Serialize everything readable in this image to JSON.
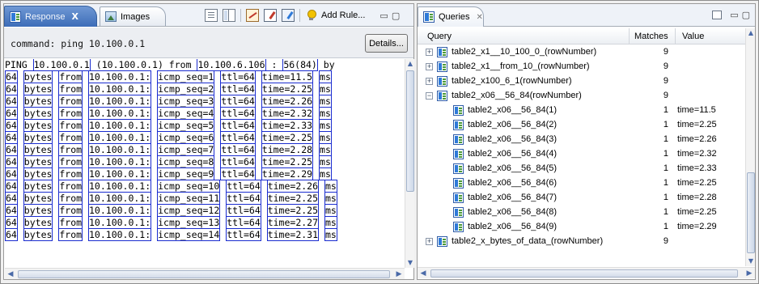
{
  "left_pane": {
    "tabs": [
      {
        "label": "Response",
        "close": "X",
        "icon": "response-grid-icon",
        "active": true
      },
      {
        "label": "Images",
        "icon": "images-icon",
        "active": false
      }
    ],
    "toolbar": {
      "add_rule_label": "Add Rule...",
      "icons": [
        "document-view-icon",
        "columns-view-icon",
        "wand-icon",
        "edit-rule-icon",
        "edit-rule-alt-icon",
        "bulb-icon"
      ],
      "min_glyph": "▭",
      "max_glyph": "▢"
    },
    "command": "command: ping 10.100.0.1",
    "details_label": "Details...",
    "output_lines": [
      [
        "PING ",
        "10.100.0.1",
        " (10.100.0.1) from ",
        "10.100.6.106",
        " : ",
        "56(84)",
        " by"
      ],
      [
        "64",
        " ",
        "bytes",
        " ",
        "from",
        " ",
        "10.100.0.1:",
        " ",
        "icmp_seq=1",
        " ",
        "ttl=64",
        " ",
        "time=11.5",
        " ",
        "ms"
      ],
      [
        "64",
        " ",
        "bytes",
        " ",
        "from",
        " ",
        "10.100.0.1:",
        " ",
        "icmp_seq=2",
        " ",
        "ttl=64",
        " ",
        "time=2.25",
        " ",
        "ms"
      ],
      [
        "64",
        " ",
        "bytes",
        " ",
        "from",
        " ",
        "10.100.0.1:",
        " ",
        "icmp_seq=3",
        " ",
        "ttl=64",
        " ",
        "time=2.26",
        " ",
        "ms"
      ],
      [
        "64",
        " ",
        "bytes",
        " ",
        "from",
        " ",
        "10.100.0.1:",
        " ",
        "icmp_seq=4",
        " ",
        "ttl=64",
        " ",
        "time=2.32",
        " ",
        "ms"
      ],
      [
        "64",
        " ",
        "bytes",
        " ",
        "from",
        " ",
        "10.100.0.1:",
        " ",
        "icmp_seq=5",
        " ",
        "ttl=64",
        " ",
        "time=2.33",
        " ",
        "ms"
      ],
      [
        "64",
        " ",
        "bytes",
        " ",
        "from",
        " ",
        "10.100.0.1:",
        " ",
        "icmp_seq=6",
        " ",
        "ttl=64",
        " ",
        "time=2.25",
        " ",
        "ms"
      ],
      [
        "64",
        " ",
        "bytes",
        " ",
        "from",
        " ",
        "10.100.0.1:",
        " ",
        "icmp_seq=7",
        " ",
        "ttl=64",
        " ",
        "time=2.28",
        " ",
        "ms"
      ],
      [
        "64",
        " ",
        "bytes",
        " ",
        "from",
        " ",
        "10.100.0.1:",
        " ",
        "icmp_seq=8",
        " ",
        "ttl=64",
        " ",
        "time=2.25",
        " ",
        "ms"
      ],
      [
        "64",
        " ",
        "bytes",
        " ",
        "from",
        " ",
        "10.100.0.1:",
        " ",
        "icmp_seq=9",
        " ",
        "ttl=64",
        " ",
        "time=2.29",
        " ",
        "ms"
      ],
      [
        "64",
        " ",
        "bytes",
        " ",
        "from",
        " ",
        "10.100.0.1:",
        " ",
        "icmp_seq=10",
        " ",
        "ttl=64",
        " ",
        "time=2.26",
        " ",
        "ms"
      ],
      [
        "64",
        " ",
        "bytes",
        " ",
        "from",
        " ",
        "10.100.0.1:",
        " ",
        "icmp_seq=11",
        " ",
        "ttl=64",
        " ",
        "time=2.25",
        " ",
        "ms"
      ],
      [
        "64",
        " ",
        "bytes",
        " ",
        "from",
        " ",
        "10.100.0.1:",
        " ",
        "icmp_seq=12",
        " ",
        "ttl=64",
        " ",
        "time=2.25",
        " ",
        "ms"
      ],
      [
        "64",
        " ",
        "bytes",
        " ",
        "from",
        " ",
        "10.100.0.1:",
        " ",
        "icmp_seq=13",
        " ",
        "ttl=64",
        " ",
        "time=2.27",
        " ",
        "ms"
      ],
      [
        "64",
        " ",
        "bytes",
        " ",
        "from",
        " ",
        "10.100.0.1:",
        " ",
        "icmp_seq=14",
        " ",
        "ttl=64",
        " ",
        "time=2.31",
        " ",
        "ms"
      ]
    ],
    "scroll": {
      "up": "▲",
      "down": "▼",
      "left": "◀",
      "right": "▶"
    }
  },
  "right_pane": {
    "tab": {
      "label": "Queries",
      "close": "✕",
      "icon": "queries-icon"
    },
    "headers": {
      "query": "Query",
      "matches": "Matches",
      "value": "Value"
    },
    "rows": [
      {
        "expander": "+",
        "indent": 0,
        "name": "table2_x1__10_100_0_(rowNumber)",
        "matches": "9",
        "value": ""
      },
      {
        "expander": "+",
        "indent": 0,
        "name": "table2_x1__from_10_(rowNumber)",
        "matches": "9",
        "value": ""
      },
      {
        "expander": "+",
        "indent": 0,
        "name": "table2_x100_6_1(rowNumber)",
        "matches": "9",
        "value": ""
      },
      {
        "expander": "−",
        "indent": 0,
        "name": "table2_x06__56_84(rowNumber)",
        "matches": "9",
        "value": ""
      },
      {
        "expander": "",
        "indent": 1,
        "name": "table2_x06__56_84(1)",
        "matches": "1",
        "value": "time=11.5"
      },
      {
        "expander": "",
        "indent": 1,
        "name": "table2_x06__56_84(2)",
        "matches": "1",
        "value": "time=2.25"
      },
      {
        "expander": "",
        "indent": 1,
        "name": "table2_x06__56_84(3)",
        "matches": "1",
        "value": "time=2.26"
      },
      {
        "expander": "",
        "indent": 1,
        "name": "table2_x06__56_84(4)",
        "matches": "1",
        "value": "time=2.32"
      },
      {
        "expander": "",
        "indent": 1,
        "name": "table2_x06__56_84(5)",
        "matches": "1",
        "value": "time=2.33"
      },
      {
        "expander": "",
        "indent": 1,
        "name": "table2_x06__56_84(6)",
        "matches": "1",
        "value": "time=2.25"
      },
      {
        "expander": "",
        "indent": 1,
        "name": "table2_x06__56_84(7)",
        "matches": "1",
        "value": "time=2.28"
      },
      {
        "expander": "",
        "indent": 1,
        "name": "table2_x06__56_84(8)",
        "matches": "1",
        "value": "time=2.25"
      },
      {
        "expander": "",
        "indent": 1,
        "name": "table2_x06__56_84(9)",
        "matches": "1",
        "value": "time=2.29"
      },
      {
        "expander": "+",
        "indent": 0,
        "name": "table2_x_bytes_of_data_(rowNumber)",
        "matches": "9",
        "value": ""
      }
    ],
    "window_controls": {
      "min": "▭",
      "max": "▢"
    },
    "scroll": {
      "up": "▲",
      "down": "▼",
      "left": "◀",
      "right": "▶"
    }
  },
  "colors": {
    "active_tab": "#3d6db8",
    "token_border": "#1a2ccf",
    "grid_icon": "#2f7ad8"
  }
}
